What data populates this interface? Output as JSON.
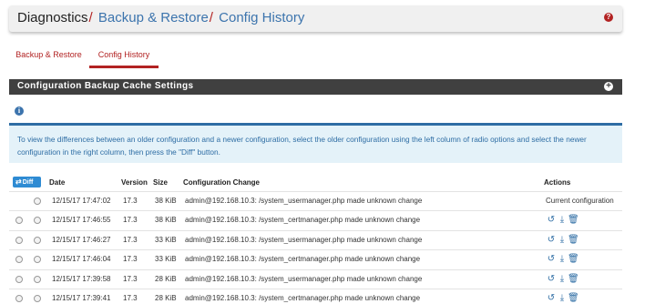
{
  "breadcrumb": {
    "root": "Diagnostics",
    "separator": "/",
    "crumb1": "Backup & Restore",
    "crumb2": "Config History"
  },
  "help_icon": "question-circle-icon",
  "tabs": [
    {
      "label": "Backup & Restore",
      "active": false
    },
    {
      "label": "Config History",
      "active": true
    }
  ],
  "section": {
    "title": "Configuration Backup Cache Settings",
    "toggle_icon": "plus-circle-icon"
  },
  "info": {
    "icon": "info-circle-icon",
    "text": "To view the differences between an older configuration and a newer configuration, select the older configuration using the left column of radio options and select the newer configuration in the right column, then press the \"Diff\" button."
  },
  "table": {
    "diff_label": "Diff",
    "headers": {
      "date": "Date",
      "version": "Version",
      "size": "Size",
      "change": "Configuration Change",
      "actions": "Actions"
    },
    "rows": [
      {
        "date": "12/15/17 17:47:02",
        "version": "17.3",
        "size": "38 KiB",
        "change": "admin@192.168.10.3: /system_usermanager.php made unknown change",
        "current": "Current configuration"
      },
      {
        "date": "12/15/17 17:46:55",
        "version": "17.3",
        "size": "38 KiB",
        "change": "admin@192.168.10.3: /system_certmanager.php made unknown change",
        "current": ""
      },
      {
        "date": "12/15/17 17:46:27",
        "version": "17.3",
        "size": "33 KiB",
        "change": "admin@192.168.10.3: /system_usermanager.php made unknown change",
        "current": ""
      },
      {
        "date": "12/15/17 17:46:04",
        "version": "17.3",
        "size": "33 KiB",
        "change": "admin@192.168.10.3: /system_certmanager.php made unknown change",
        "current": ""
      },
      {
        "date": "12/15/17 17:39:58",
        "version": "17.3",
        "size": "28 KiB",
        "change": "admin@192.168.10.3: /system_usermanager.php made unknown change",
        "current": ""
      },
      {
        "date": "12/15/17 17:39:41",
        "version": "17.3",
        "size": "28 KiB",
        "change": "admin@192.168.10.3: /system_certmanager.php made unknown change",
        "current": ""
      }
    ]
  },
  "colors": {
    "accent_red": "#b22222",
    "link_blue": "#3c74ad",
    "section_bar": "#404040",
    "info_bg": "#e4f2f9",
    "diff_button": "#2e8bd3"
  }
}
